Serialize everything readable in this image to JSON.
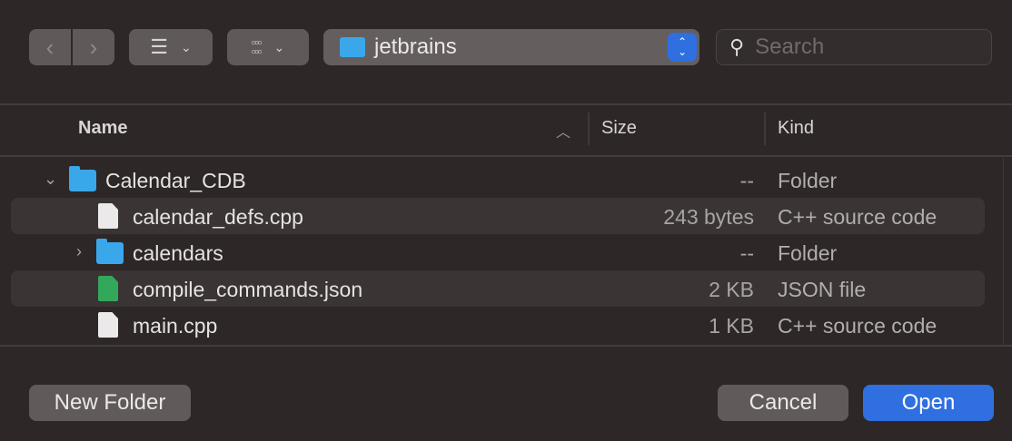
{
  "toolbar": {
    "back": "back-icon",
    "forward": "forward-icon",
    "view_list": "list-icon",
    "group": "group-icon",
    "location": "jetbrains",
    "search_placeholder": "Search"
  },
  "columns": {
    "name": "Name",
    "size": "Size",
    "kind": "Kind"
  },
  "rows": [
    {
      "name": "Calendar_CDB",
      "size": "--",
      "kind": "Folder"
    },
    {
      "name": "calendar_defs.cpp",
      "size": "243 bytes",
      "kind": "C++ source code"
    },
    {
      "name": "calendars",
      "size": "--",
      "kind": "Folder"
    },
    {
      "name": "compile_commands.json",
      "size": "2 KB",
      "kind": "JSON file"
    },
    {
      "name": "main.cpp",
      "size": "1 KB",
      "kind": "C++ source code"
    }
  ],
  "buttons": {
    "new_folder": "New Folder",
    "cancel": "Cancel",
    "open": "Open"
  },
  "colors": {
    "accent": "#2f6fe0",
    "background": "#2d2727"
  }
}
